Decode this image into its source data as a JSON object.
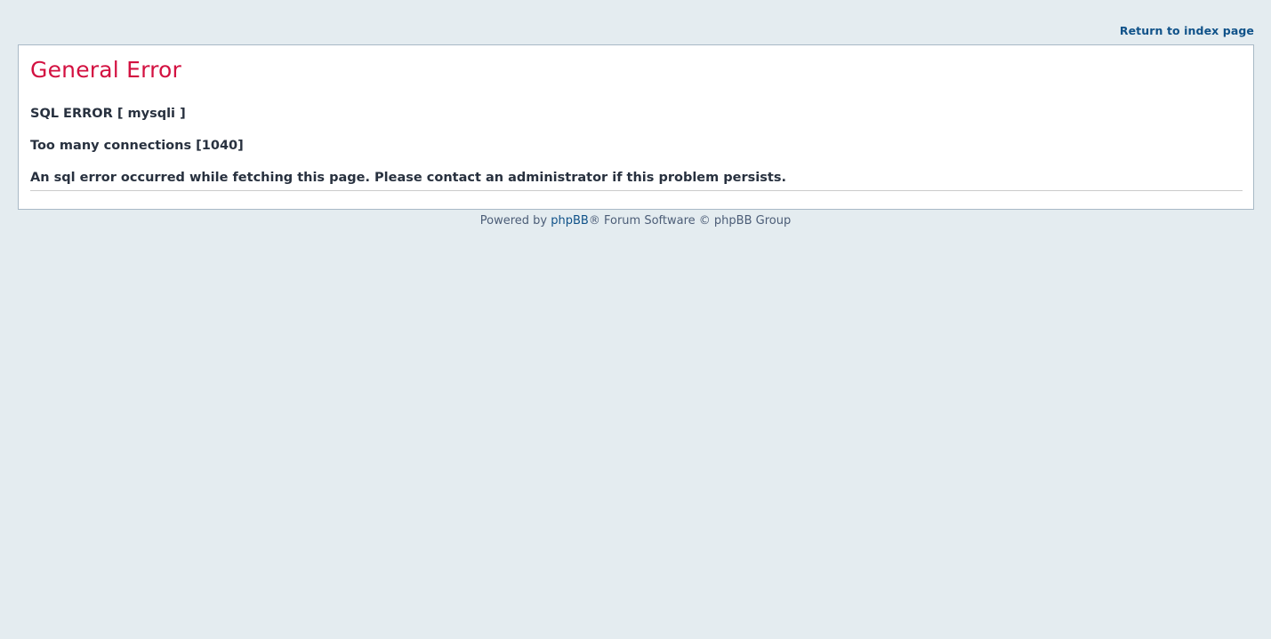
{
  "header": {
    "return_link": "Return to index page"
  },
  "error": {
    "title": "General Error",
    "sql_error": "SQL ERROR [ mysqli ]",
    "detail": "Too many connections [1040]",
    "message": "An sql error occurred while fetching this page. Please contact an administrator if this problem persists."
  },
  "footer": {
    "prefix": "Powered by ",
    "link_text": "phpBB",
    "suffix": "® Forum Software © phpBB Group"
  },
  "colors": {
    "background": "#e4ecf0",
    "title": "#d31141",
    "link": "#105289",
    "text": "#28313f"
  }
}
